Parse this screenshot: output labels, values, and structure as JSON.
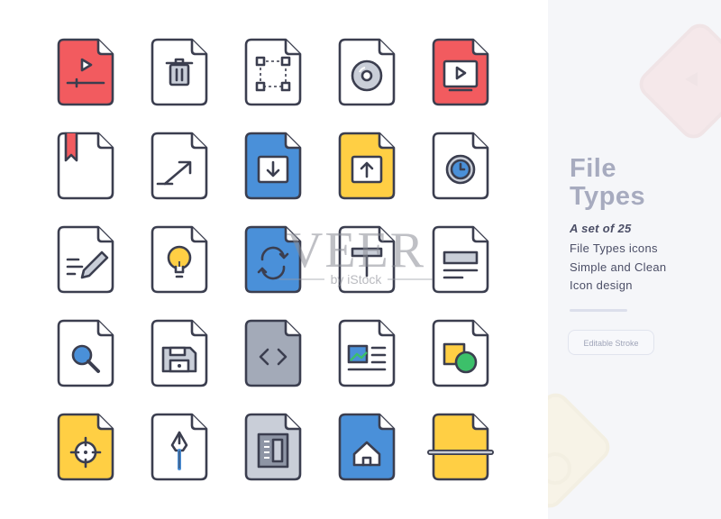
{
  "sidebar": {
    "title_line1": "File",
    "title_line2": "Types",
    "subtitle": "A set of 25",
    "desc": [
      "File Types icons",
      "Simple and Clean",
      "Icon design"
    ],
    "badge": "Editable Stroke"
  },
  "watermark": {
    "brand": "VEER",
    "sub": "by iStock"
  },
  "icons": [
    {
      "name": "video-file-icon",
      "fill": "#f25b5f",
      "glyph": "play-timeline"
    },
    {
      "name": "delete-file-icon",
      "fill": "#ffffff",
      "glyph": "trash"
    },
    {
      "name": "vector-file-icon",
      "fill": "#ffffff",
      "glyph": "vector"
    },
    {
      "name": "disc-file-icon",
      "fill": "#ffffff",
      "glyph": "disc"
    },
    {
      "name": "media-player-file-icon",
      "fill": "#f25b5f",
      "glyph": "play-screen"
    },
    {
      "name": "bookmark-file-icon",
      "fill": "#ffffff",
      "glyph": "bookmark"
    },
    {
      "name": "export-file-icon",
      "fill": "#ffffff",
      "glyph": "export"
    },
    {
      "name": "download-file-icon",
      "fill": "#4a90d9",
      "glyph": "download"
    },
    {
      "name": "upload-file-icon",
      "fill": "#ffcf44",
      "glyph": "upload"
    },
    {
      "name": "clock-file-icon",
      "fill": "#ffffff",
      "glyph": "clock"
    },
    {
      "name": "edit-file-icon",
      "fill": "#ffffff",
      "glyph": "pencil"
    },
    {
      "name": "idea-file-icon",
      "fill": "#ffffff",
      "glyph": "bulb"
    },
    {
      "name": "sync-file-icon",
      "fill": "#4a90d9",
      "glyph": "sync"
    },
    {
      "name": "text-file-icon",
      "fill": "#ffffff",
      "glyph": "text"
    },
    {
      "name": "document-file-icon",
      "fill": "#ffffff",
      "glyph": "doc"
    },
    {
      "name": "search-file-icon",
      "fill": "#ffffff",
      "glyph": "search"
    },
    {
      "name": "save-file-icon",
      "fill": "#ffffff",
      "glyph": "floppy"
    },
    {
      "name": "code-file-icon",
      "fill": "#a3aab8",
      "glyph": "code"
    },
    {
      "name": "image-document-file-icon",
      "fill": "#ffffff",
      "glyph": "image-doc"
    },
    {
      "name": "shapes-file-icon",
      "fill": "#ffffff",
      "glyph": "shapes"
    },
    {
      "name": "target-file-icon",
      "fill": "#ffcf44",
      "glyph": "target"
    },
    {
      "name": "pen-tool-file-icon",
      "fill": "#ffffff",
      "glyph": "pen"
    },
    {
      "name": "archive-file-icon",
      "fill": "#c9ced8",
      "glyph": "archive"
    },
    {
      "name": "home-file-icon",
      "fill": "#4a90d9",
      "glyph": "home"
    },
    {
      "name": "cut-file-icon",
      "fill": "#ffcf44",
      "glyph": "cut"
    }
  ],
  "colors": {
    "stroke": "#3b3e4f",
    "red": "#f25b5f",
    "blue": "#4a90d9",
    "yellow": "#ffcf44",
    "gray": "#a3aab8",
    "green": "#3cc06a",
    "panel": "#f5f6f9"
  }
}
